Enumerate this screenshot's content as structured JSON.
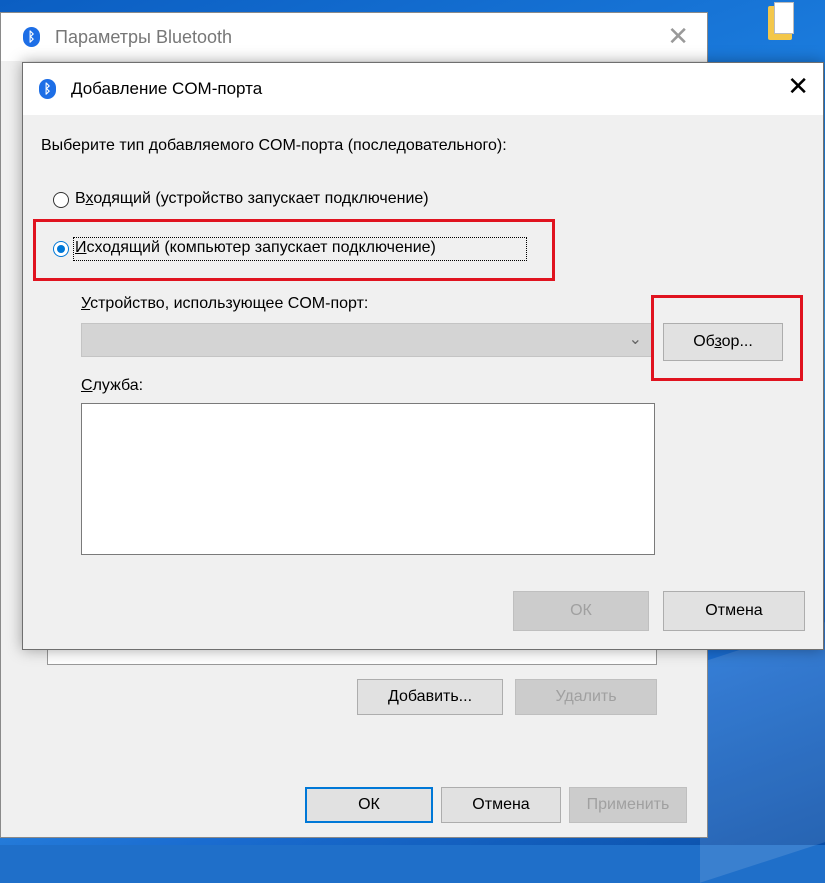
{
  "back_window": {
    "title": "Параметры Bluetooth",
    "close_glyph": "✕",
    "add_button": "Добавить...",
    "remove_button": "Удалить",
    "ok_button": "ОК",
    "cancel_button": "Отмена",
    "apply_button": "Применить"
  },
  "dialog": {
    "title": "Добавление COM-порта",
    "close_glyph": "✕",
    "prompt": "Выберите тип добавляемого COM-порта (последовательного):",
    "incoming": {
      "prefix": "В",
      "accel": "х",
      "rest": "одящий (устройство запускает подключение)",
      "selected": false
    },
    "outgoing": {
      "accel": "И",
      "rest": "сходящий (компьютер запускает подключение)",
      "selected": true
    },
    "device_label": {
      "accel": "У",
      "rest": "стройство, использующее COM-порт:"
    },
    "device_value": "",
    "browse_button": {
      "prefix": "Об",
      "accel": "з",
      "rest": "ор..."
    },
    "service_label": {
      "accel": "С",
      "rest": "лужба:"
    },
    "ok_button": "ОК",
    "cancel_button": "Отмена"
  },
  "colors": {
    "accent": "#0078d7",
    "highlight": "#e0131f",
    "bluetooth": "#1d6ee6"
  }
}
